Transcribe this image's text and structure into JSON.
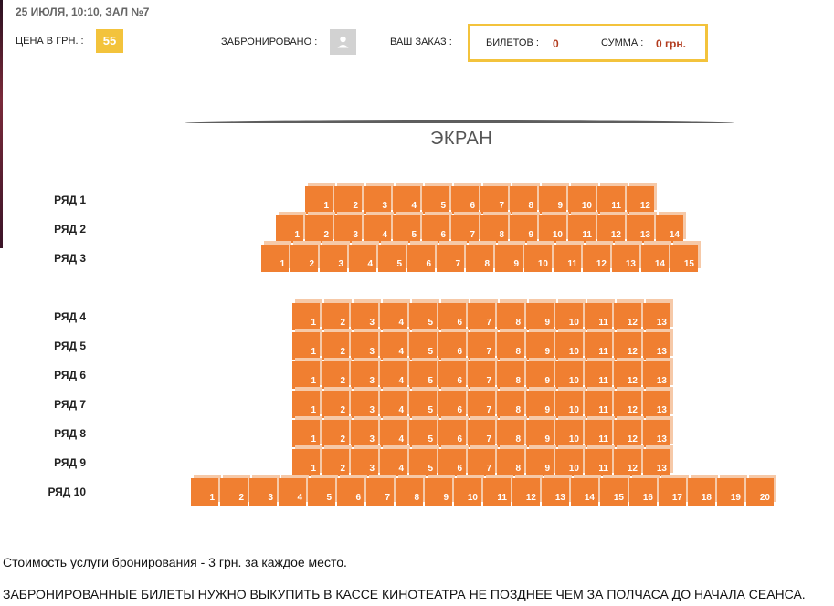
{
  "session": "25 ИЮЛЯ, 10:10, ЗАЛ №7",
  "header": {
    "price_label": "ЦЕНА В ГРН. :",
    "price_value": "55",
    "booked_label": "ЗАБРОНИРОВАНО :",
    "order_label": "ВАШ ЗАКАЗ :",
    "tickets_label": "БИЛЕТОВ :",
    "tickets_value": "0",
    "sum_label": "СУММА :",
    "sum_value": "0 грн."
  },
  "screen_label": "ЭКРАН",
  "rows": [
    {
      "label": "РЯД 1",
      "seats": 12
    },
    {
      "label": "РЯД 2",
      "seats": 14
    },
    {
      "label": "РЯД 3",
      "seats": 15
    },
    {
      "label": "РЯД 4",
      "seats": 13
    },
    {
      "label": "РЯД 5",
      "seats": 13
    },
    {
      "label": "РЯД 6",
      "seats": 13
    },
    {
      "label": "РЯД 7",
      "seats": 13
    },
    {
      "label": "РЯД 8",
      "seats": 13
    },
    {
      "label": "РЯД 9",
      "seats": 13
    },
    {
      "label": "РЯД 10",
      "seats": 20
    }
  ],
  "notes": {
    "service_fee": "Стоимость услуги бронирования - 3 грн. за каждое место.",
    "pickup": "ЗАБРОНИРОВАННЫЕ БИЛЕТЫ НУЖНО ВЫКУПИТЬ В КАССЕ КИНОТЕАТРА НЕ ПОЗДНЕЕ ЧЕМ ЗА ПОЛЧАСА ДО НАЧАЛА СЕАНСА."
  },
  "colors": {
    "seat_available": "#f07f31",
    "accent_yellow": "#f3c33c",
    "order_value": "#b23b1e"
  },
  "icons": {
    "booked_seat": "person-icon"
  }
}
